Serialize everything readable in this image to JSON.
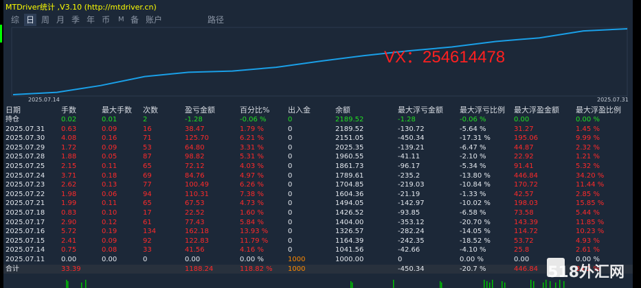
{
  "title": "MTDriver统计 ,V3.10 (http://mtdriver.cn)",
  "tabs": [
    "综",
    "日",
    "周",
    "月",
    "季",
    "年",
    "币",
    "M",
    "备",
    "账户",
    "路径"
  ],
  "active_tab": "日",
  "chart": {
    "watermark": "VX：254614478",
    "x_start": "2025.07.14",
    "x_end": "2025.07.31",
    "line_color": "#1aa0e8",
    "balance_points": [
      1000.0,
      1041.56,
      1164.39,
      1326.57,
      1404.0,
      1426.52,
      1494.05,
      1604.36,
      1704.85,
      1789.61,
      1861.73,
      1960.55,
      2025.35,
      2151.05,
      2189.52
    ]
  },
  "columns": [
    "日期",
    "手数",
    "最大手数",
    "次数",
    "盈亏金额",
    "百分比%",
    "出入金",
    "余额",
    "最大浮亏金额",
    "最大浮亏比例",
    "最大浮盈金额",
    "最大浮盈比例"
  ],
  "position_row": {
    "label": "持仓",
    "lots": "0.02",
    "max_lots": "0.01",
    "count": "2",
    "pnl": "-1.28",
    "pct": "-0.06 %",
    "deposit": "0",
    "balance": "2189.52",
    "max_dd": "-1.28",
    "max_dd_pct": "-0.06 %",
    "max_fp": "0.00",
    "max_fp_pct": "0.00 %"
  },
  "rows": [
    {
      "date": "2025.07.31",
      "lots": "0.63",
      "max_lots": "0.09",
      "count": "16",
      "pnl": "38.47",
      "pct": "1.79 %",
      "deposit": "0",
      "balance": "2189.52",
      "max_dd": "-130.72",
      "max_dd_pct": "-5.64 %",
      "max_fp": "31.27",
      "max_fp_pct": "1.45 %"
    },
    {
      "date": "2025.07.30",
      "lots": "4.08",
      "max_lots": "0.16",
      "count": "71",
      "pnl": "125.70",
      "pct": "6.21 %",
      "deposit": "0",
      "balance": "2151.05",
      "max_dd": "-450.34",
      "max_dd_pct": "-17.31 %",
      "max_fp": "195.06",
      "max_fp_pct": "9.99 %"
    },
    {
      "date": "2025.07.29",
      "lots": "1.72",
      "max_lots": "0.09",
      "count": "53",
      "pnl": "64.80",
      "pct": "3.31 %",
      "deposit": "0",
      "balance": "2025.35",
      "max_dd": "-139.21",
      "max_dd_pct": "-6.47 %",
      "max_fp": "44.87",
      "max_fp_pct": "2.32 %"
    },
    {
      "date": "2025.07.28",
      "lots": "1.88",
      "max_lots": "0.05",
      "count": "87",
      "pnl": "98.82",
      "pct": "5.31 %",
      "deposit": "0",
      "balance": "1960.55",
      "max_dd": "-41.11",
      "max_dd_pct": "-2.10 %",
      "max_fp": "22.92",
      "max_fp_pct": "1.21 %"
    },
    {
      "date": "2025.07.25",
      "lots": "2.15",
      "max_lots": "0.11",
      "count": "65",
      "pnl": "72.12",
      "pct": "4.03 %",
      "deposit": "0",
      "balance": "1861.73",
      "max_dd": "-96.17",
      "max_dd_pct": "-5.34 %",
      "max_fp": "91.41",
      "max_fp_pct": "5.32 %"
    },
    {
      "date": "2025.07.24",
      "lots": "3.71",
      "max_lots": "0.18",
      "count": "69",
      "pnl": "84.76",
      "pct": "4.97 %",
      "deposit": "0",
      "balance": "1789.61",
      "max_dd": "-235.2",
      "max_dd_pct": "-13.80 %",
      "max_fp": "446.84",
      "max_fp_pct": "34.20 %"
    },
    {
      "date": "2025.07.23",
      "lots": "2.62",
      "max_lots": "0.13",
      "count": "77",
      "pnl": "100.49",
      "pct": "6.26 %",
      "deposit": "0",
      "balance": "1704.85",
      "max_dd": "-219.03",
      "max_dd_pct": "-10.84 %",
      "max_fp": "170.72",
      "max_fp_pct": "11.44 %"
    },
    {
      "date": "2025.07.22",
      "lots": "1.98",
      "max_lots": "0.06",
      "count": "94",
      "pnl": "110.31",
      "pct": "7.38 %",
      "deposit": "0",
      "balance": "1604.36",
      "max_dd": "-21.19",
      "max_dd_pct": "-1.33 %",
      "max_fp": "42.57",
      "max_fp_pct": "2.85 %"
    },
    {
      "date": "2025.07.21",
      "lots": "1.99",
      "max_lots": "0.11",
      "count": "65",
      "pnl": "67.53",
      "pct": "4.73 %",
      "deposit": "0",
      "balance": "1494.05",
      "max_dd": "-142.97",
      "max_dd_pct": "-10.02 %",
      "max_fp": "198.03",
      "max_fp_pct": "15.85 %"
    },
    {
      "date": "2025.07.18",
      "lots": "0.83",
      "max_lots": "0.10",
      "count": "17",
      "pnl": "22.52",
      "pct": "1.60 %",
      "deposit": "0",
      "balance": "1426.52",
      "max_dd": "-93.85",
      "max_dd_pct": "-6.58 %",
      "max_fp": "73.58",
      "max_fp_pct": "5.44 %"
    },
    {
      "date": "2025.07.17",
      "lots": "2.90",
      "max_lots": "0.12",
      "count": "61",
      "pnl": "77.43",
      "pct": "5.84 %",
      "deposit": "0",
      "balance": "1404.00",
      "max_dd": "-353.12",
      "max_dd_pct": "-20.70 %",
      "max_fp": "143.39",
      "max_fp_pct": "11.85 %"
    },
    {
      "date": "2025.07.16",
      "lots": "5.72",
      "max_lots": "0.19",
      "count": "134",
      "pnl": "162.18",
      "pct": "13.93 %",
      "deposit": "0",
      "balance": "1326.57",
      "max_dd": "-282.24",
      "max_dd_pct": "-14.05 %",
      "max_fp": "114.72",
      "max_fp_pct": "10.23 %"
    },
    {
      "date": "2025.07.15",
      "lots": "2.41",
      "max_lots": "0.09",
      "count": "92",
      "pnl": "122.83",
      "pct": "11.79 %",
      "deposit": "0",
      "balance": "1164.39",
      "max_dd": "-242.35",
      "max_dd_pct": "-18.52 %",
      "max_fp": "53.72",
      "max_fp_pct": "4.93 %"
    },
    {
      "date": "2025.07.14",
      "lots": "0.75",
      "max_lots": "0.08",
      "count": "33",
      "pnl": "41.56",
      "pct": "4.16 %",
      "deposit": "0",
      "balance": "1041.56",
      "max_dd": "-42.66",
      "max_dd_pct": "-4.10 %",
      "max_fp": "25.8",
      "max_fp_pct": "2.61 %"
    },
    {
      "date": "2025.07.11",
      "lots": "0.00",
      "max_lots": "0.00",
      "count": "0",
      "pnl": "0.00",
      "pct": "0.00 %",
      "deposit": "1000",
      "balance": "1000.00",
      "max_dd": "0",
      "max_dd_pct": "0.00 %",
      "max_fp": "0.00",
      "max_fp_pct": "0.00 %"
    }
  ],
  "total_row": {
    "label": "合计",
    "lots": "33.39",
    "pnl": "1188.24",
    "pct": "118.82 %",
    "deposit": "1000",
    "max_dd": "-450.34",
    "max_dd_pct": "-20.7 %",
    "max_fp": "446.84",
    "max_fp_pct": "34.2 %"
  },
  "site_watermark": "518外汇网",
  "colors": {
    "background": "#1c2838",
    "title": "#ffff00",
    "positive": "#ff2a2a",
    "position": "#22e022",
    "deposit": "#ff8a00",
    "watermark": "#ff2020"
  }
}
